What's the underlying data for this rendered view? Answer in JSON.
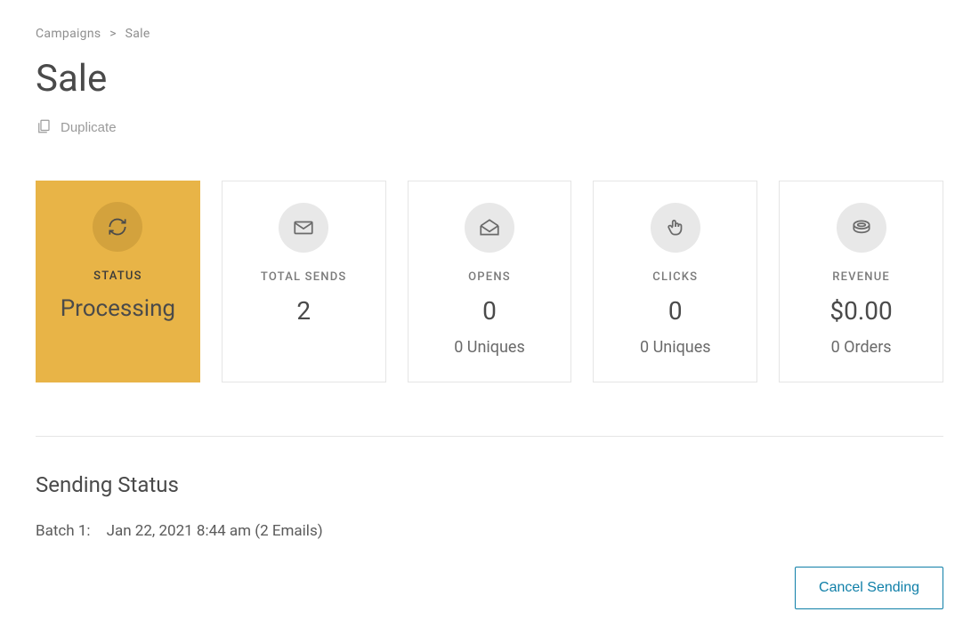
{
  "breadcrumb": {
    "parent": "Campaigns",
    "current": "Sale"
  },
  "page_title": "Sale",
  "duplicate_label": "Duplicate",
  "cards": {
    "status": {
      "label": "STATUS",
      "value": "Processing",
      "icon": "refresh-icon"
    },
    "total_sends": {
      "label": "TOTAL SENDS",
      "value": "2",
      "icon": "envelope-icon"
    },
    "opens": {
      "label": "OPENS",
      "value": "0",
      "subvalue": "0 Uniques",
      "icon": "envelope-open-icon"
    },
    "clicks": {
      "label": "CLICKS",
      "value": "0",
      "subvalue": "0 Uniques",
      "icon": "pointer-icon"
    },
    "revenue": {
      "label": "REVENUE",
      "value": "$0.00",
      "subvalue": "0 Orders",
      "icon": "coin-icon"
    }
  },
  "sending_status": {
    "title": "Sending Status",
    "batch_label": "Batch 1:",
    "batch_detail": "Jan 22, 2021 8:44 am (2 Emails)",
    "cancel_label": "Cancel Sending"
  }
}
